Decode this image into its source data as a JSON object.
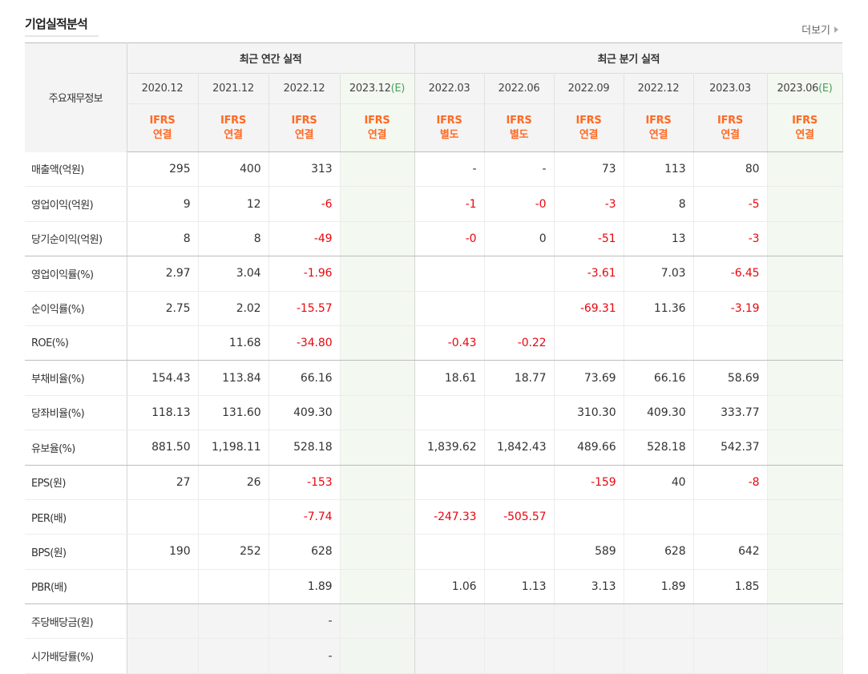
{
  "header": {
    "title": "기업실적분석",
    "more_label": "더보기"
  },
  "table": {
    "corner_label": "주요재무정보",
    "groups": {
      "annual": "최근 연간 실적",
      "quarterly": "최근 분기 실적"
    },
    "periods": [
      "2020.12",
      "2021.12",
      "2022.12",
      "2023.12",
      "2022.03",
      "2022.06",
      "2022.09",
      "2022.12",
      "2023.03",
      "2023.06"
    ],
    "estimate_suffix": "(E)",
    "ifrs_top": "IFRS",
    "basis": [
      "연결",
      "연결",
      "연결",
      "연결",
      "별도",
      "별도",
      "연결",
      "연결",
      "연결",
      "연결"
    ],
    "rows": [
      {
        "label": "매출액(억원)",
        "values": [
          "295",
          "400",
          "313",
          "",
          "-",
          "-",
          "73",
          "113",
          "80",
          ""
        ]
      },
      {
        "label": "영업이익(억원)",
        "values": [
          "9",
          "12",
          "-6",
          "",
          "-1",
          "-0",
          "-3",
          "8",
          "-5",
          ""
        ]
      },
      {
        "label": "당기순이익(억원)",
        "values": [
          "8",
          "8",
          "-49",
          "",
          "-0",
          "0",
          "-51",
          "13",
          "-3",
          ""
        ]
      },
      {
        "label": "영업이익률(%)",
        "values": [
          "2.97",
          "3.04",
          "-1.96",
          "",
          "",
          "",
          "-3.61",
          "7.03",
          "-6.45",
          ""
        ]
      },
      {
        "label": "순이익률(%)",
        "values": [
          "2.75",
          "2.02",
          "-15.57",
          "",
          "",
          "",
          "-69.31",
          "11.36",
          "-3.19",
          ""
        ]
      },
      {
        "label": "ROE(%)",
        "values": [
          "",
          "11.68",
          "-34.80",
          "",
          "-0.43",
          "-0.22",
          "",
          "",
          "",
          ""
        ]
      },
      {
        "label": "부채비율(%)",
        "values": [
          "154.43",
          "113.84",
          "66.16",
          "",
          "18.61",
          "18.77",
          "73.69",
          "66.16",
          "58.69",
          ""
        ]
      },
      {
        "label": "당좌비율(%)",
        "values": [
          "118.13",
          "131.60",
          "409.30",
          "",
          "",
          "",
          "310.30",
          "409.30",
          "333.77",
          ""
        ]
      },
      {
        "label": "유보율(%)",
        "values": [
          "881.50",
          "1,198.11",
          "528.18",
          "",
          "1,839.62",
          "1,842.43",
          "489.66",
          "528.18",
          "542.37",
          ""
        ]
      },
      {
        "label": "EPS(원)",
        "values": [
          "27",
          "26",
          "-153",
          "",
          "",
          "",
          "-159",
          "40",
          "-8",
          ""
        ]
      },
      {
        "label": "PER(배)",
        "values": [
          "",
          "",
          "-7.74",
          "",
          "-247.33",
          "-505.57",
          "",
          "",
          "",
          ""
        ]
      },
      {
        "label": "BPS(원)",
        "values": [
          "190",
          "252",
          "628",
          "",
          "",
          "",
          "589",
          "628",
          "642",
          ""
        ]
      },
      {
        "label": "PBR(배)",
        "values": [
          "",
          "",
          "1.89",
          "",
          "1.06",
          "1.13",
          "3.13",
          "1.89",
          "1.85",
          ""
        ]
      },
      {
        "label": "주당배당금(원)",
        "values": [
          "",
          "",
          "-",
          "",
          "",
          "",
          "",
          "",
          "",
          ""
        ]
      },
      {
        "label": "시가배당률(%)",
        "values": [
          "",
          "",
          "-",
          "",
          "",
          "",
          "",
          "",
          "",
          ""
        ]
      }
    ]
  },
  "colors": {
    "negative": "#e8070f",
    "ifrs": "#ff6a23",
    "estimate_tag": "#4ba159",
    "estimate_bg": "#f3f8f1",
    "header_bg": "#f4f4f4"
  }
}
